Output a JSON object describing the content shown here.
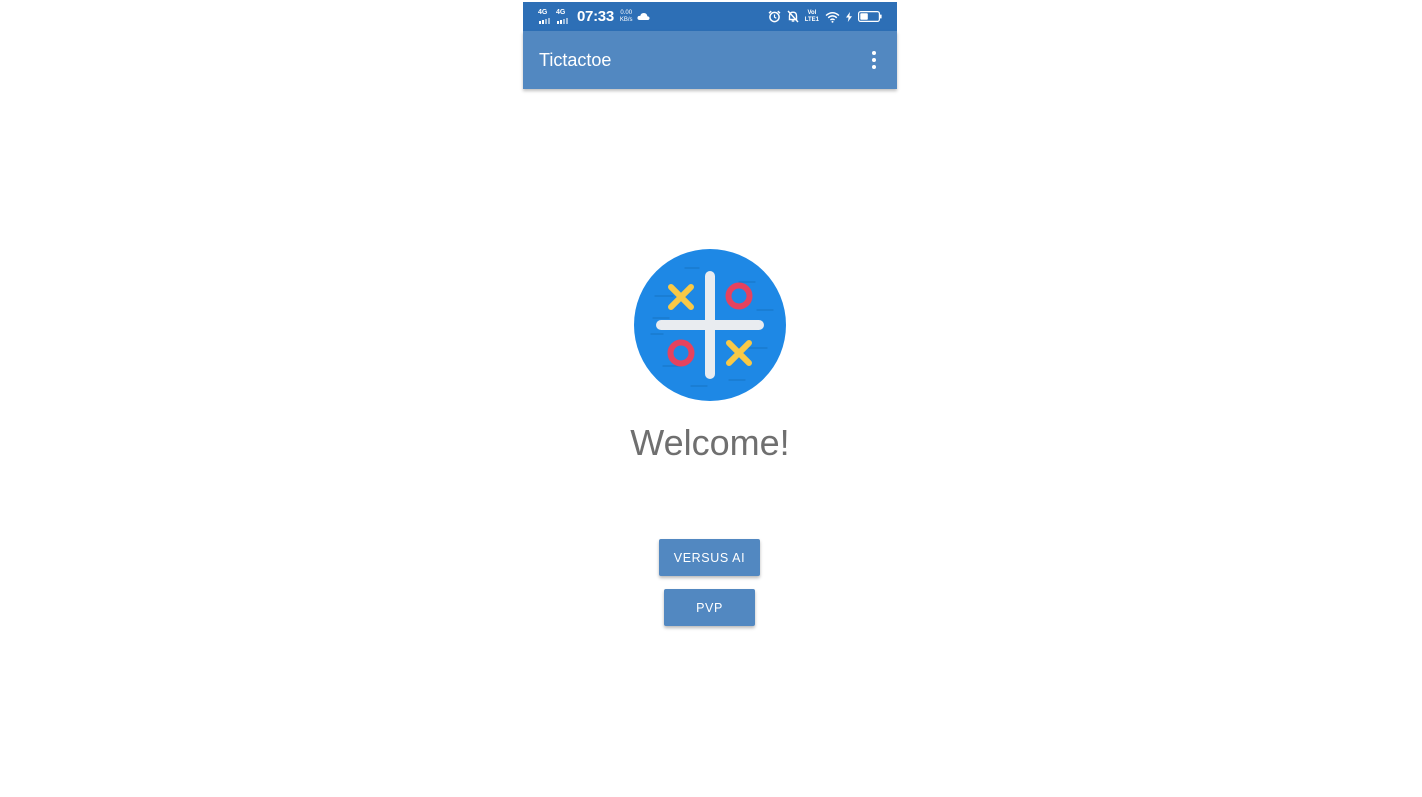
{
  "status_bar": {
    "network_1": "4G",
    "network_2": "4G",
    "time": "07:33",
    "speed_value": "0.00",
    "speed_unit": "KB/s",
    "volte_top": "Vol",
    "volte_bottom": "LTE1",
    "icons": [
      "cloud-icon",
      "alarm-icon",
      "dnd-icon",
      "wifi-icon",
      "charging-icon",
      "battery-icon"
    ],
    "color": "#2d6fb6"
  },
  "app_bar": {
    "title": "Tictactoe",
    "menu_icon": "more-vert-icon",
    "color": "#5288c1"
  },
  "main": {
    "logo_icon": "tictactoe-logo-icon",
    "welcome_text": "Welcome!",
    "buttons": {
      "versus_ai": "VERSUS AI",
      "pvp": "PVP"
    }
  },
  "colors": {
    "accent": "#5288c1",
    "logo_bg": "#1e88e5",
    "x_mark": "#f9c946",
    "o_mark": "#e6425e"
  }
}
